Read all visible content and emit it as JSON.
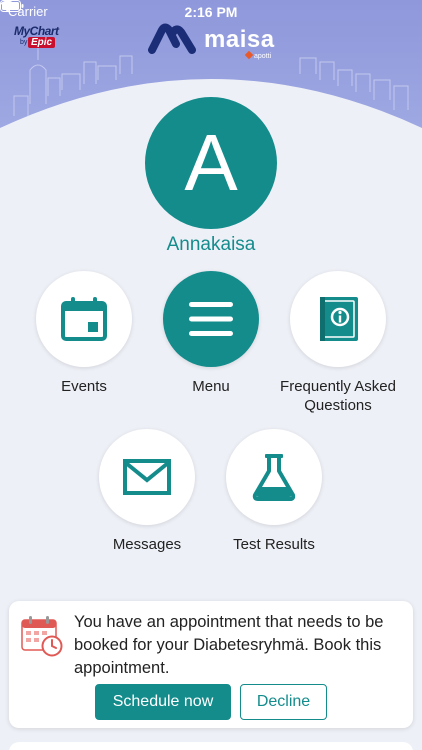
{
  "status_bar": {
    "carrier": "Carrier",
    "time": "2:16 PM"
  },
  "logos": {
    "mychart": {
      "name": "MyChart",
      "by": "by",
      "epic": "Epic"
    },
    "brand": {
      "name": "maisa",
      "sub": "apotti"
    }
  },
  "colors": {
    "header": "#8f9bdc",
    "accent": "#148c8c",
    "background": "#eef0f7"
  },
  "profile": {
    "initial": "A",
    "name": "Annakaisa"
  },
  "tiles": [
    {
      "label": "Events",
      "icon": "calendar-icon"
    },
    {
      "label": "Menu",
      "icon": "hamburger-menu-icon"
    },
    {
      "label": "Frequently Asked Questions",
      "icon": "faq-book-icon"
    },
    {
      "label": "Messages",
      "icon": "envelope-icon"
    },
    {
      "label": "Test Results",
      "icon": "flask-icon"
    }
  ],
  "notification": {
    "icon": "calendar-clock-icon",
    "text": "You have an appointment that needs to be booked for your Diabetesryhmä. Book this appointment.",
    "primary_label": "Schedule now",
    "secondary_label": "Decline"
  }
}
